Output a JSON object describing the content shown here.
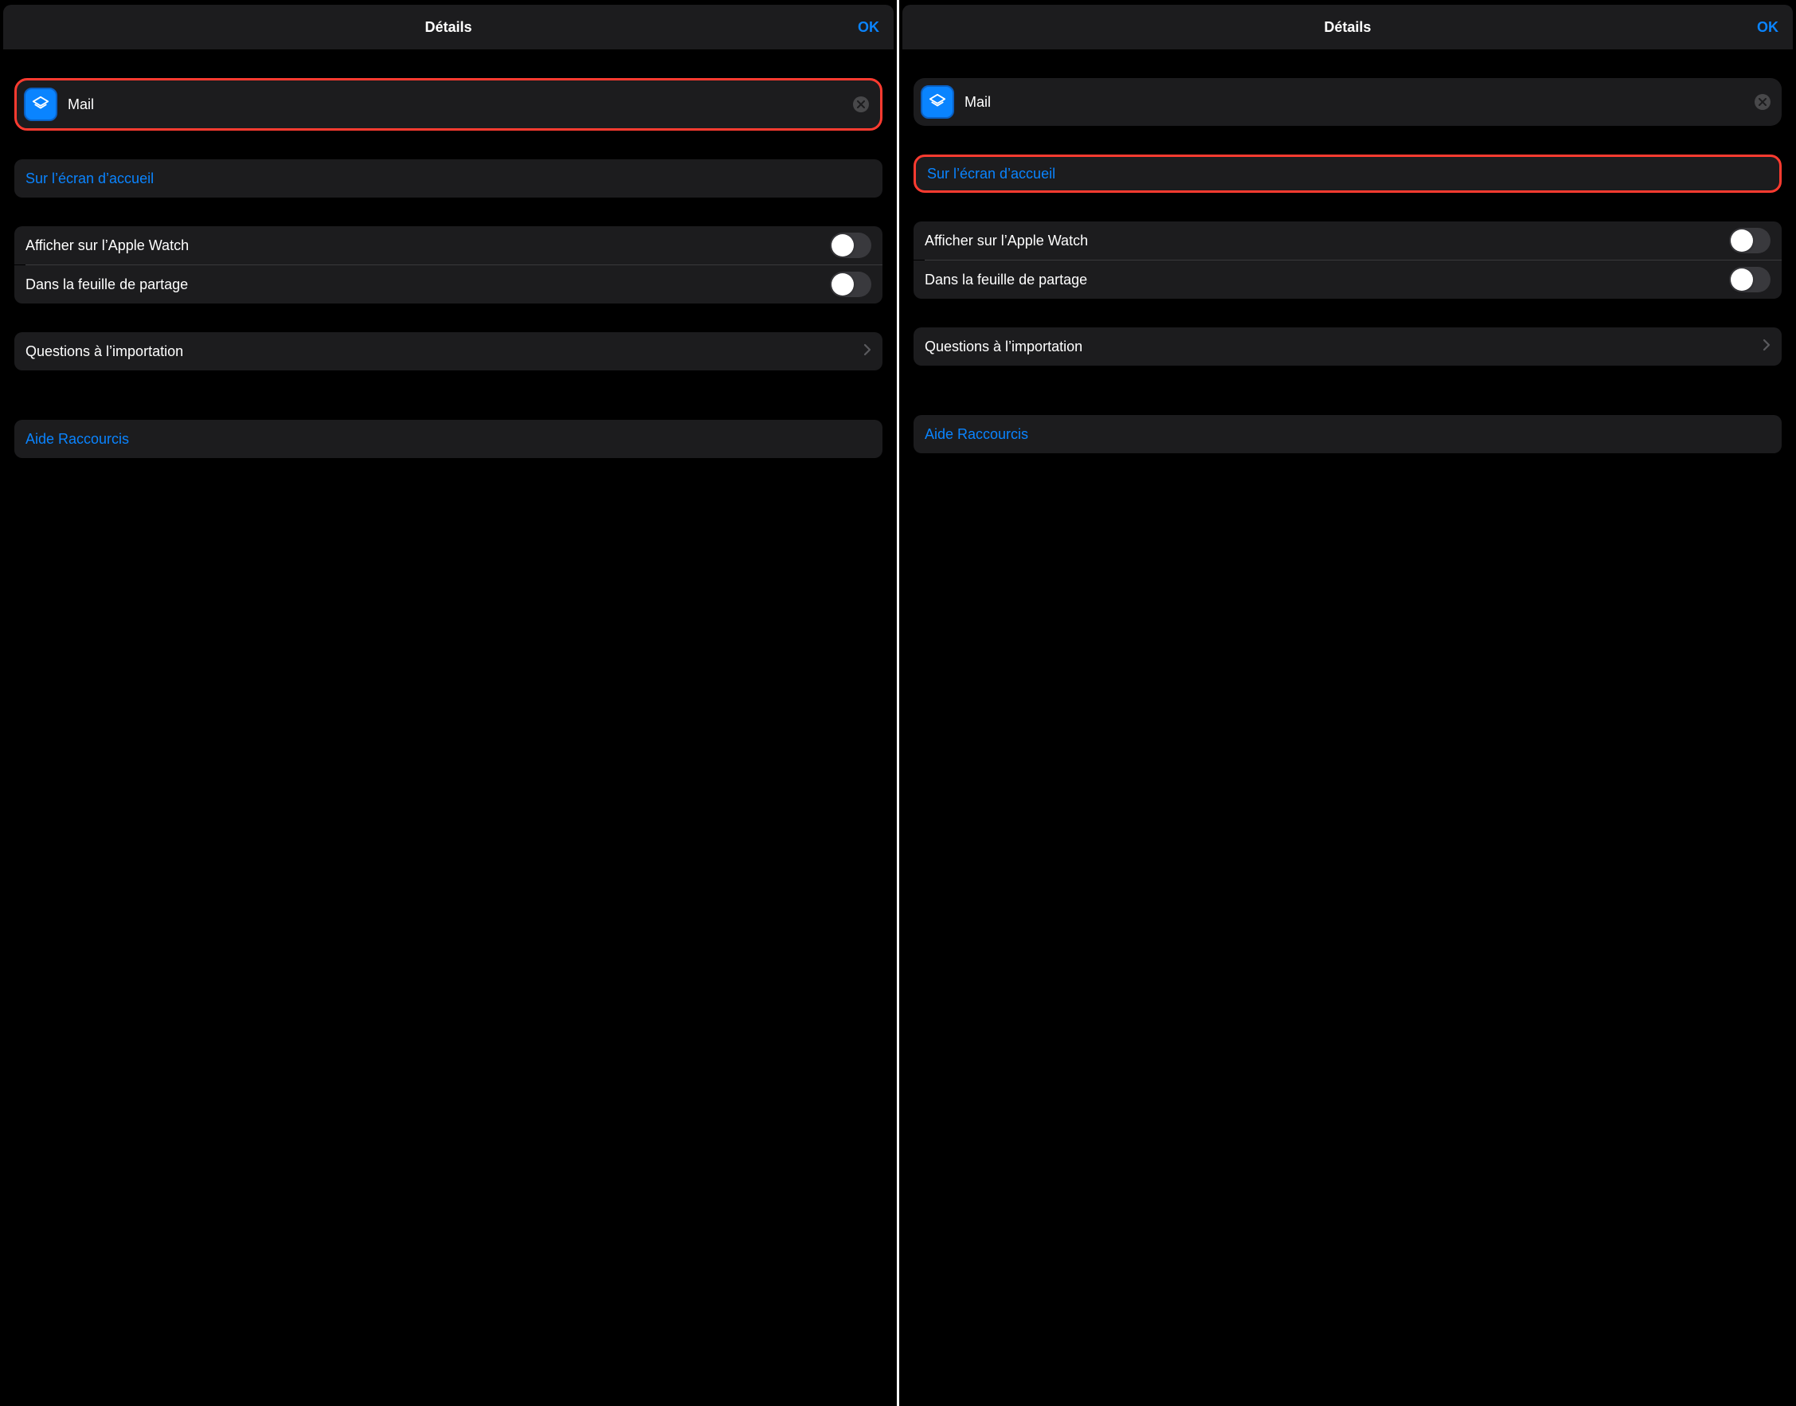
{
  "left": {
    "header": {
      "title": "Détails",
      "ok": "OK"
    },
    "shortcut_name": "Mail",
    "home_screen": "Sur l’écran d’accueil",
    "apple_watch": "Afficher sur l’Apple Watch",
    "share_sheet": "Dans la feuille de partage",
    "import_questions": "Questions à l’importation",
    "help": "Aide Raccourcis"
  },
  "right": {
    "header": {
      "title": "Détails",
      "ok": "OK"
    },
    "shortcut_name": "Mail",
    "home_screen": "Sur l’écran d’accueil",
    "apple_watch": "Afficher sur l’Apple Watch",
    "share_sheet": "Dans la feuille de partage",
    "import_questions": "Questions à l’importation",
    "help": "Aide Raccourcis"
  }
}
